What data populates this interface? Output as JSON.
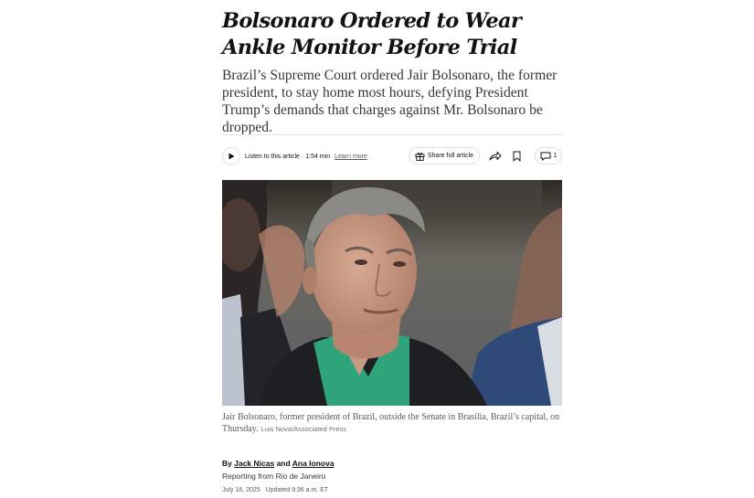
{
  "article": {
    "headline": "Bolsonaro Ordered to Wear Ankle Monitor Before Trial",
    "summary": "Brazil’s Supreme Court ordered Jair Bolsonaro, the former president, to stay home most hours, defying President Trump’s demands that charges against Mr. Bolsonaro be dropped."
  },
  "toolbar": {
    "listen_label": "Listen to this article",
    "separator": "·",
    "duration": "1:54 min",
    "learn_more": "Learn more",
    "share_label": "Share full article",
    "comment_count": "1",
    "icons": [
      "play-icon",
      "gift-icon",
      "share-arrow-icon",
      "bookmark-icon",
      "comment-icon"
    ]
  },
  "photo": {
    "caption": "Jair Bolsonaro, former president of Brazil, outside the Senate in Brasília, Brazil’s capital, on Thursday.",
    "credit": "Luis Nova/Associated Press"
  },
  "byline": {
    "prefix": "By",
    "author1": "Jack Nicas",
    "conjunction": "and",
    "author2": "Ana Ionova",
    "dateline": "Reporting from Rio de Janeiro",
    "published": "July 18, 2025",
    "updated": "Updated 9:36 a.m. ET"
  },
  "colors": {
    "text": "#121212",
    "secondary_text": "#5a5a5a",
    "border": "#dfdfdf",
    "shirt_green": "#2fa37a"
  }
}
